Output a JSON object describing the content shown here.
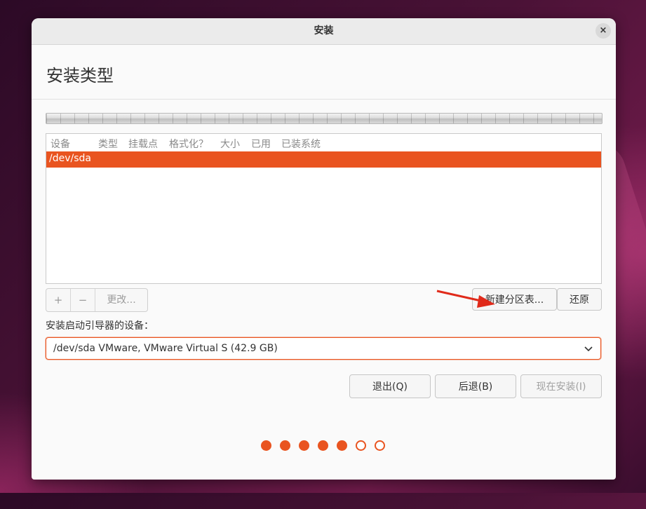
{
  "window": {
    "title": "安装",
    "close_glyph": "×"
  },
  "page": {
    "title": "安装类型"
  },
  "table": {
    "columns": [
      "设备",
      "类型",
      "挂载点",
      "格式化？",
      "大小",
      "已用",
      "已装系统"
    ],
    "rows": [
      {
        "device": "/dev/sda",
        "selected": true
      }
    ]
  },
  "toolbar": {
    "add_label": "+",
    "remove_label": "−",
    "change_label": "更改...",
    "new_table_label": "新建分区表...",
    "revert_label": "还原"
  },
  "boot": {
    "label": "安装启动引导器的设备：",
    "selected": "/dev/sda VMware, VMware Virtual S (42.9 GB)"
  },
  "buttons": {
    "quit": "退出(Q)",
    "back": "后退(B)",
    "install": "现在安装(I)"
  },
  "progress": {
    "current_step": 5,
    "total_steps": 7
  },
  "colors": {
    "accent": "#e95420",
    "annotation_arrow": "#e02a1a"
  },
  "icons": {
    "close": "close-icon",
    "dropdown": "chevron-down-icon"
  }
}
